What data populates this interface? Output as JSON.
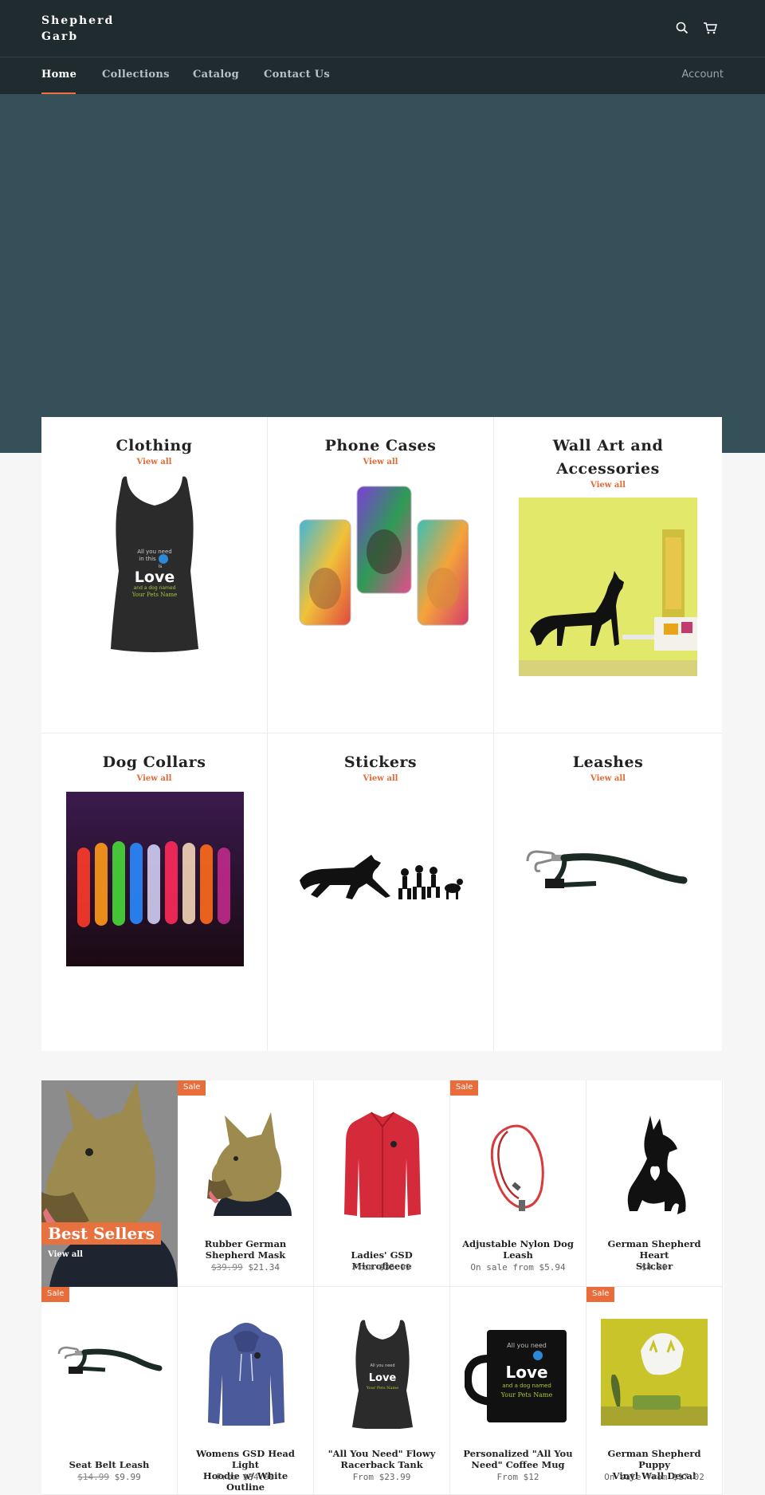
{
  "header": {
    "logo_line1": "Shepherd",
    "logo_line2": "Garb",
    "search_icon": "search-icon",
    "cart_icon": "cart-icon"
  },
  "nav": {
    "items": [
      {
        "label": "Home",
        "active": true
      },
      {
        "label": "Collections"
      },
      {
        "label": "Catalog"
      },
      {
        "label": "Contact Us"
      }
    ],
    "account_label": "Account"
  },
  "collections": [
    {
      "title": "Clothing",
      "link": "View all"
    },
    {
      "title": "Phone Cases",
      "link": "View all"
    },
    {
      "title_line1": "Wall Art and",
      "title_line2": "Accessories",
      "link": "View all"
    },
    {
      "title": "Dog Collars",
      "link": "View all"
    },
    {
      "title": "Stickers",
      "link": "View all"
    },
    {
      "title": "Leashes",
      "link": "View all"
    }
  ],
  "featured": {
    "title": "Best Sellers",
    "link": "View all"
  },
  "products": [
    {
      "sale": "Sale",
      "name_line1": "Rubber German",
      "name_line2": "Shepherd Mask",
      "old_price": "$39.99",
      "price": "$21.34"
    },
    {
      "name_line1": "Ladies' GSD Microfleece",
      "price": "From $35.99"
    },
    {
      "sale": "Sale",
      "name_line1": "Adjustable Nylon Dog",
      "name_line2": "Leash",
      "price": "On sale from $5.94"
    },
    {
      "name_line1": "German Shepherd Heart",
      "name_line2": "Sticker",
      "price": "$4.99"
    },
    {
      "sale": "Sale",
      "name_line1": "Seat Belt Leash",
      "old_price": "$14.99",
      "price": "$9.99"
    },
    {
      "name_line1": "Womens GSD Head Light",
      "name_line2": "Hoodie w/ White Outline",
      "price": "From $34.99"
    },
    {
      "name_line1": "\"All You Need\" Flowy",
      "name_line2": "Racerback Tank",
      "price": "From $23.99"
    },
    {
      "name_line1": "Personalized \"All You",
      "name_line2": "Need\" Coffee Mug",
      "price": "From $12"
    },
    {
      "sale": "Sale",
      "name_line1": "German Shepherd Puppy",
      "name_line2": "Vinyl Wall Decal",
      "price": "On sale from $17.02"
    }
  ],
  "image_text": {
    "tank_line1": "All you need",
    "tank_line2": "in this",
    "tank_line3": "is",
    "tank_love": "Love",
    "tank_line4": "and a dog named",
    "tank_line5": "Your Pets Name"
  },
  "colors": {
    "header_bg": "#202b30",
    "hero_bg": "#36505a",
    "accent": "#e86d3b",
    "page_bg": "#f6f6f6"
  }
}
